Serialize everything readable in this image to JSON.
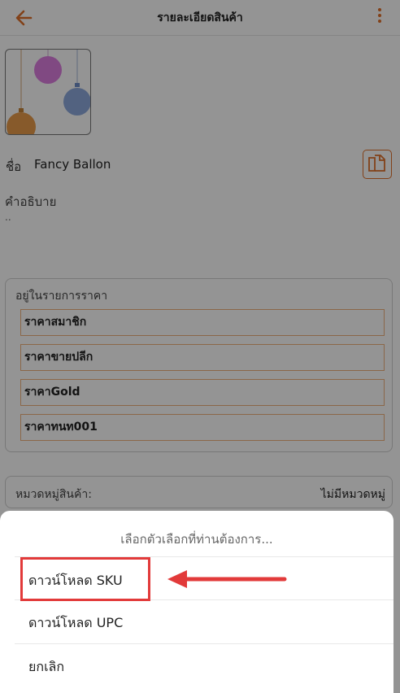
{
  "header": {
    "title": "รายละเอียดสินค้า"
  },
  "product": {
    "name_label": "ชื่อ",
    "name_value": "Fancy Ballon",
    "description_label": "คำอธิบาย",
    "description_value": ".."
  },
  "price_lists": {
    "title": "อยู่ในรายการราคา",
    "items": [
      {
        "label": "ราคาสมาชิก"
      },
      {
        "label": "ราคาขายปลีก"
      },
      {
        "label": "ราคาGold"
      },
      {
        "label": "ราคาทนท001"
      }
    ]
  },
  "category": {
    "label": "หมวดหมู่สินค้า:",
    "value": "ไม่มีหมวดหมู่"
  },
  "action_sheet": {
    "title": "เลือกตัวเลือกที่ท่านต้องการ...",
    "options": [
      {
        "label": "ดาวน์โหลด SKU"
      },
      {
        "label": "ดาวน์โหลด UPC"
      },
      {
        "label": "ยกเลิก"
      }
    ]
  },
  "colors": {
    "accent": "#e0702a",
    "annotation_red": "#e23a3a",
    "price_item_border": "#f0b27d"
  },
  "icons": {
    "back": "arrow-left-icon",
    "menu": "kebab-menu-icon",
    "copy": "copy-icon"
  }
}
